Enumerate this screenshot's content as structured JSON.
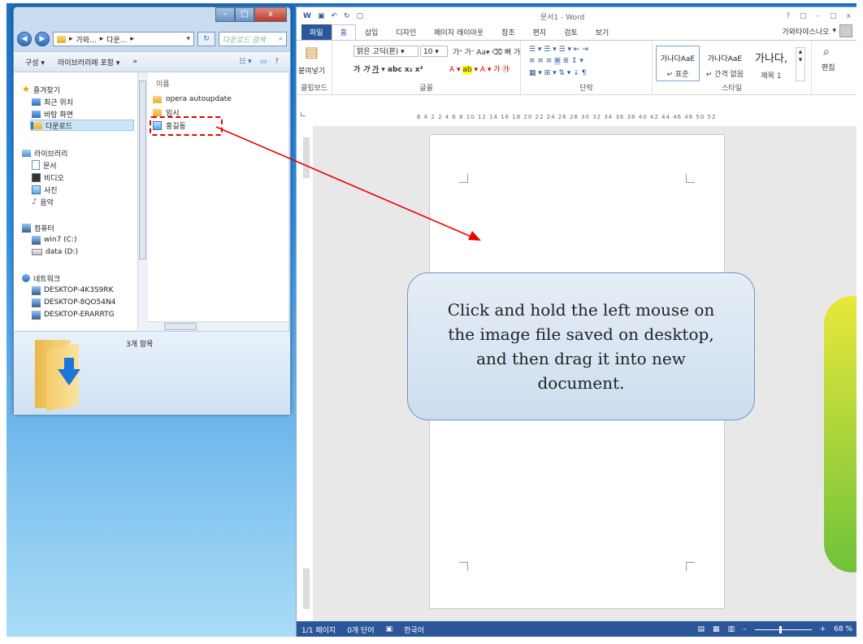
{
  "explorer": {
    "window_buttons": {
      "minimize": "–",
      "maximize": "□",
      "close": "x"
    },
    "breadcrumb": [
      "가와...",
      "다운..."
    ],
    "search_placeholder": "다운로드 검색",
    "toolbar": {
      "organize": "구성 ▾",
      "include": "라이브러리에 포함 ▾",
      "more": "»"
    },
    "nav": {
      "favorites": "즐겨찾기",
      "recent": "최근 위치",
      "desktop": "바탕 화면",
      "downloads": "다운로드",
      "libraries": "라이브러리",
      "documents": "문서",
      "videos": "비디오",
      "pictures": "사진",
      "music": "음악",
      "computer": "컴퓨터",
      "drive_c": "win7 (C:)",
      "drive_d": "data (D:)",
      "network": "네트워크",
      "net1": "DESKTOP-4K3S9RK",
      "net2": "DESKTOP-8QO54N4",
      "net3": "DESKTOP-ERARRTG"
    },
    "column_header": "이름",
    "files": [
      "opera autoupdate",
      "임시",
      "홍길동"
    ],
    "details": "3개 항목"
  },
  "word": {
    "title": "문서1 - Word",
    "title_right": [
      "?",
      "□",
      "–",
      "□",
      "x"
    ],
    "tabs": [
      "파일",
      "홈",
      "삽입",
      "디자인",
      "페이지 레이아웃",
      "참조",
      "편지",
      "검토",
      "보기"
    ],
    "account": "가와타야스나오",
    "ribbon": {
      "paste": "붙여넣기",
      "clipboard": "클립보드",
      "font_name": "맑은 고딕(본)",
      "font_size": "10",
      "font_group": "글꼴",
      "paragraph": "단락",
      "styles_group": "스타일",
      "editing": "편집",
      "styles": [
        {
          "sample": "가나다AaE",
          "name": "↵ 표준"
        },
        {
          "sample": "가나다AaE",
          "name": "↵ 간격 없음"
        },
        {
          "sample": "가나다,",
          "name": "제목 1"
        }
      ]
    },
    "ruler": "6  4  2    2  4  6  8  10  12  14  16  18  20  22  24  26  28  30  32  34  36  38  40  42  44  46  48  50  52",
    "status": {
      "page": "1/1 페이지",
      "words": "0개 단어",
      "lang": "한국어",
      "zoom": "68 %"
    }
  },
  "callout": "Click and hold the left mouse on the image file saved on desktop, and then drag it into new document.",
  "colors": {
    "highlight": "#ee0000",
    "arrow": "#ee0000",
    "word_blue": "#2b579a"
  }
}
